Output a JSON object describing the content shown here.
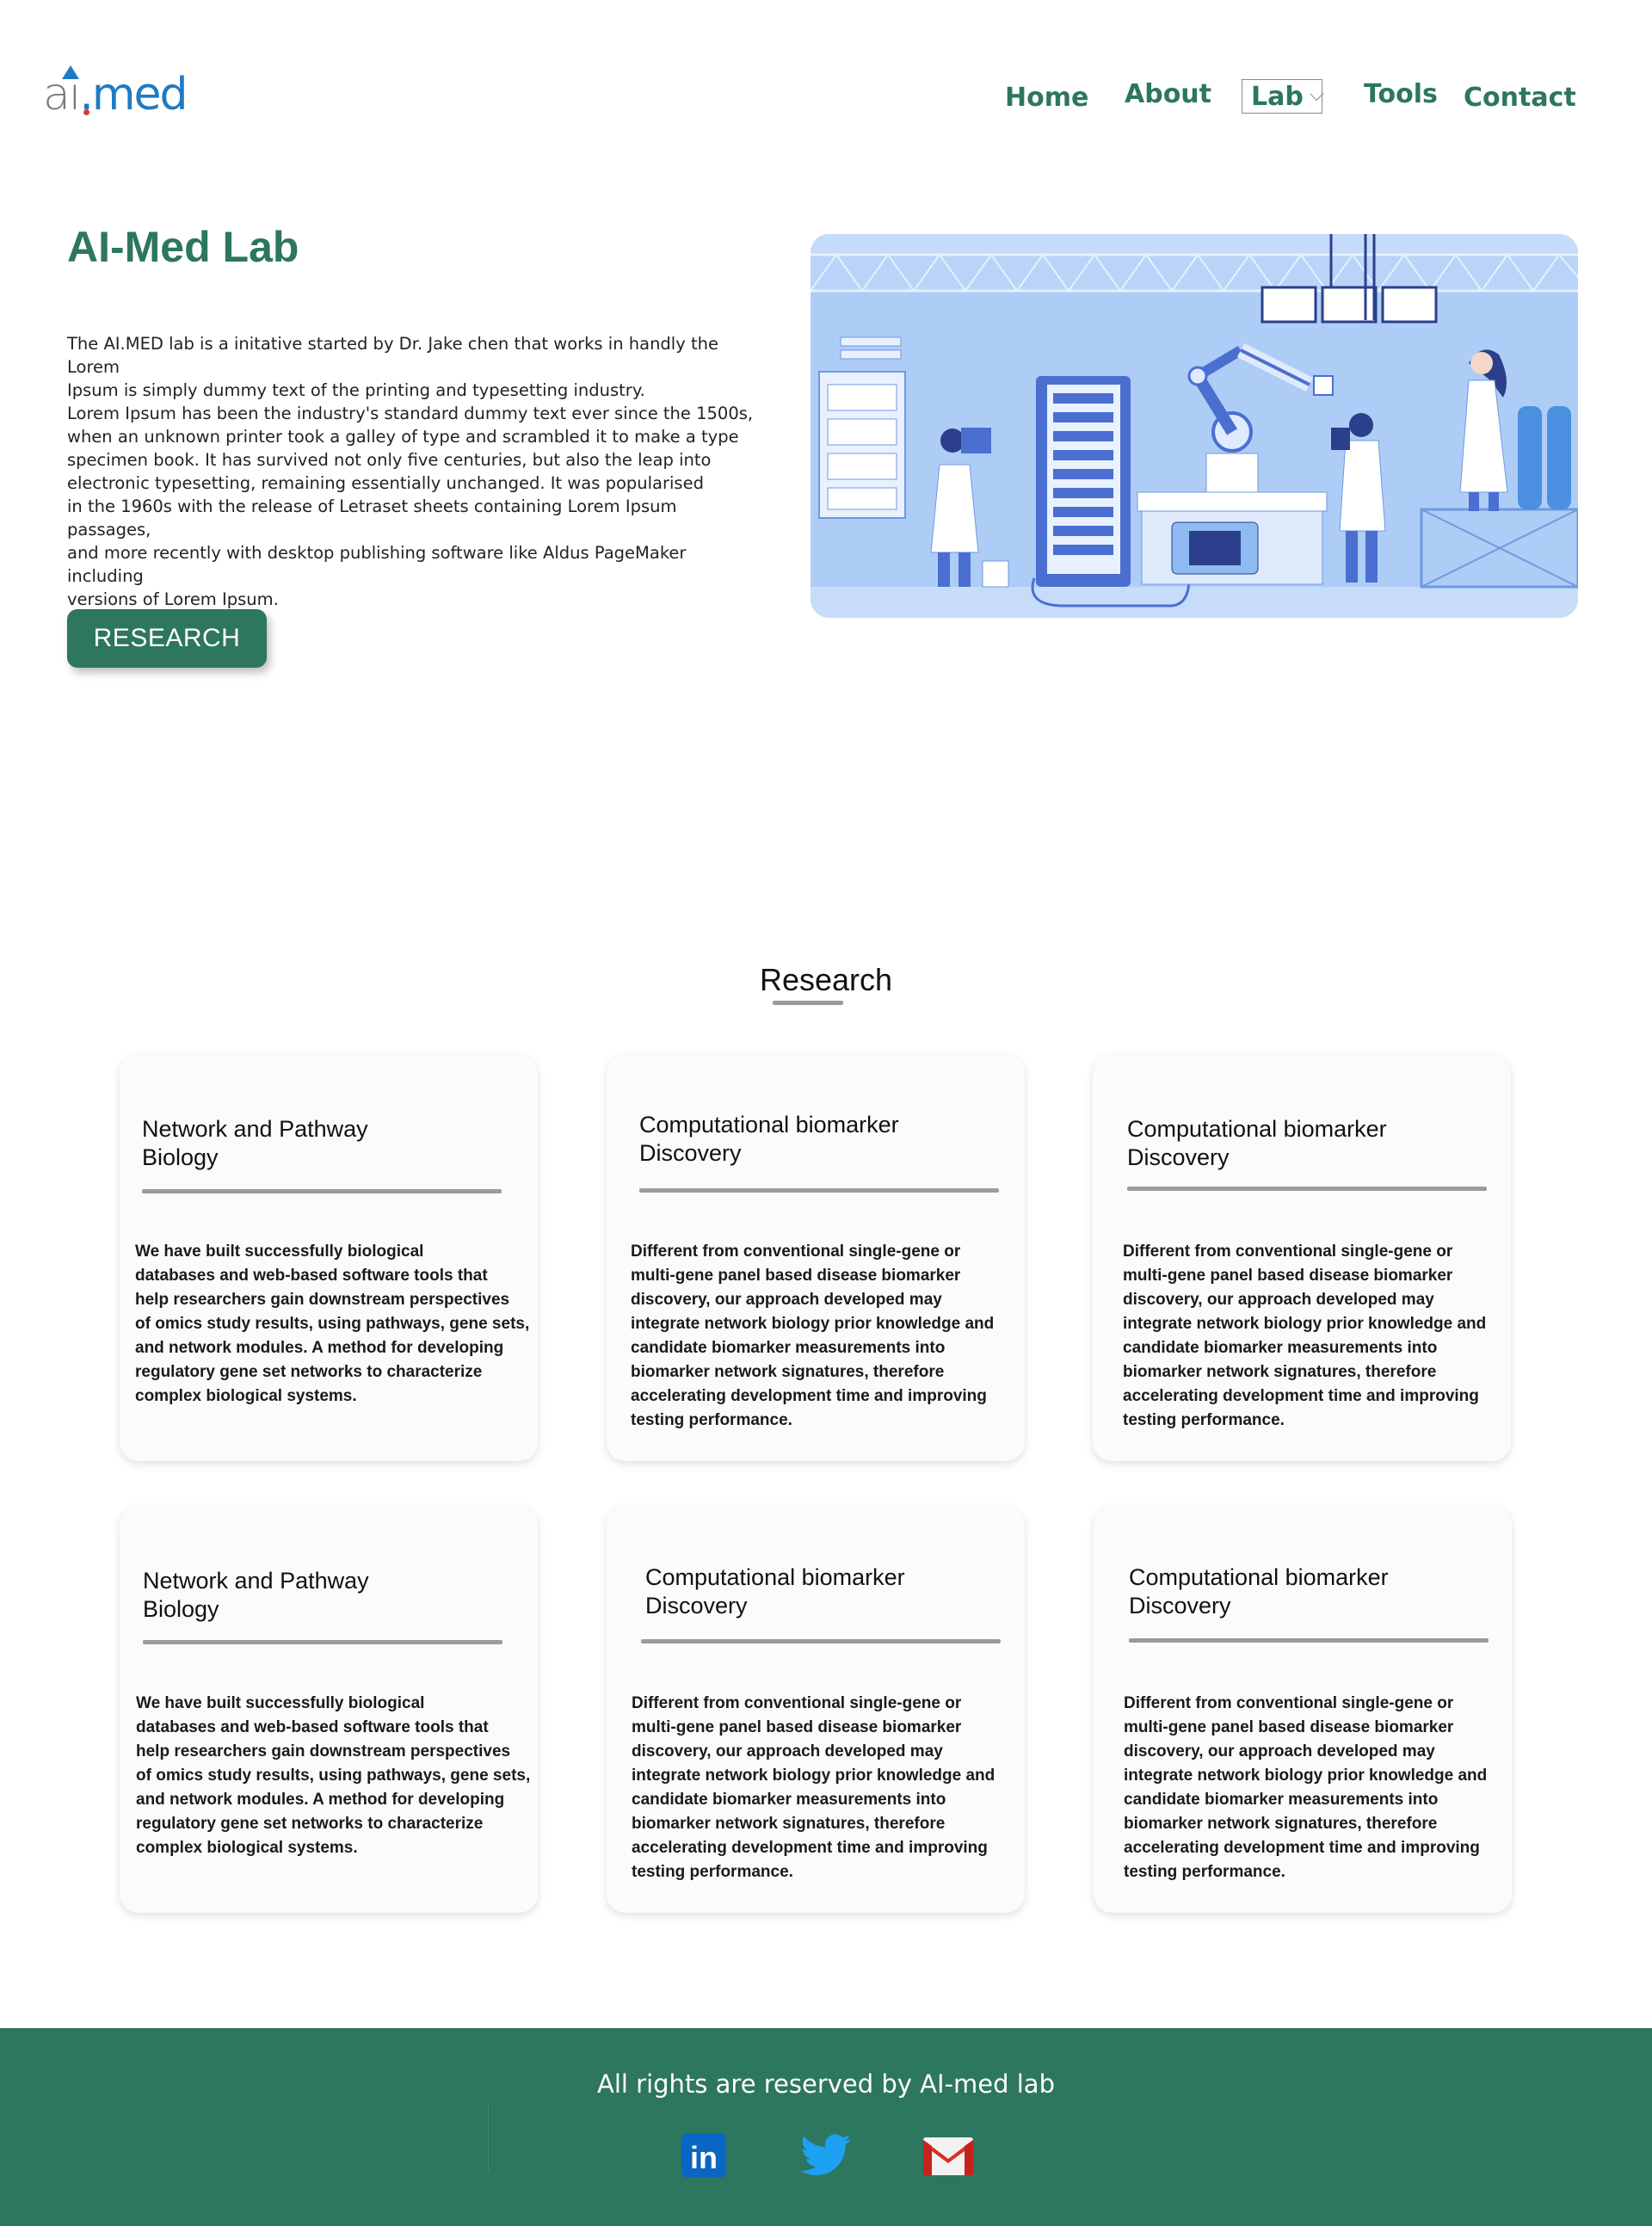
{
  "header": {
    "logo": {
      "part1": "ai",
      "part2": ".med"
    },
    "nav": [
      {
        "label": "Home"
      },
      {
        "label": "About"
      },
      {
        "label": "Lab"
      },
      {
        "label": "Tools"
      },
      {
        "label": "Contact"
      }
    ]
  },
  "hero": {
    "title": "AI-Med Lab",
    "text": "The AI.MED lab is a initative started by Dr. Jake chen that works in handly the Lorem\nIpsum is simply dummy text of the printing and typesetting industry.\nLorem Ipsum has been the industry's standard dummy text ever since the 1500s,\nwhen an unknown printer took a galley of type and scrambled it to make a type\nspecimen book. It has survived not only five centuries, but also the leap into\nelectronic typesetting, remaining essentially unchanged. It was popularised\nin the 1960s with the release of Letraset sheets containing Lorem Ipsum passages,\nand more recently with desktop publishing software like Aldus PageMaker including\nversions of Lorem Ipsum.",
    "button_label": "RESEARCH"
  },
  "research": {
    "title": "Research",
    "cards": [
      {
        "title": "Network and Pathway\nBiology",
        "body": "We have built successfully biological\ndatabases and web-based software tools that\nhelp researchers gain downstream perspectives\nof omics study results, using pathways, gene sets,\nand network modules. A method for developing\nregulatory gene set networks to characterize\ncomplex biological systems."
      },
      {
        "title": "Computational biomarker\nDiscovery",
        "body": "Different from conventional single-gene or\nmulti-gene panel based disease biomarker\ndiscovery, our approach developed may\nintegrate network biology prior knowledge and\ncandidate biomarker measurements into\n biomarker network signatures, therefore\n accelerating development time and improving\n testing performance."
      },
      {
        "title": "Computational biomarker\nDiscovery",
        "body": "Different from conventional single-gene or\nmulti-gene panel based disease biomarker\ndiscovery, our approach developed may\nintegrate network biology prior knowledge and\ncandidate biomarker measurements into\n biomarker network signatures, therefore\n accelerating development time and improving\n testing performance."
      },
      {
        "title": "Network and Pathway\nBiology",
        "body": "We have built successfully biological\ndatabases and web-based software tools that\nhelp researchers gain downstream perspectives\nof omics study results, using pathways, gene sets,\nand network modules. A method for developing\nregulatory gene set networks to characterize\ncomplex biological systems."
      },
      {
        "title": "Computational biomarker\nDiscovery",
        "body": "Different from conventional single-gene or\nmulti-gene panel based disease biomarker\ndiscovery, our approach developed may\nintegrate network biology prior knowledge and\ncandidate biomarker measurements into\n biomarker network signatures, therefore\n accelerating development time and improving\n testing performance."
      },
      {
        "title": "Computational biomarker\nDiscovery",
        "body": "Different from conventional single-gene or\nmulti-gene panel based disease biomarker\ndiscovery, our approach developed may\nintegrate network biology prior knowledge and\ncandidate biomarker measurements into\n biomarker network signatures, therefore\n accelerating development time and improving\n testing performance."
      }
    ]
  },
  "footer": {
    "text": "All rights are reserved by AI-med lab",
    "social": [
      {
        "icon": "linkedin-icon",
        "label": "in"
      },
      {
        "icon": "twitter-icon"
      },
      {
        "icon": "gmail-icon"
      }
    ]
  },
  "colors": {
    "brand_green": "#2d7660",
    "logo_blue": "#1f7ac4",
    "hero_image_bg": "#aecdf6"
  }
}
